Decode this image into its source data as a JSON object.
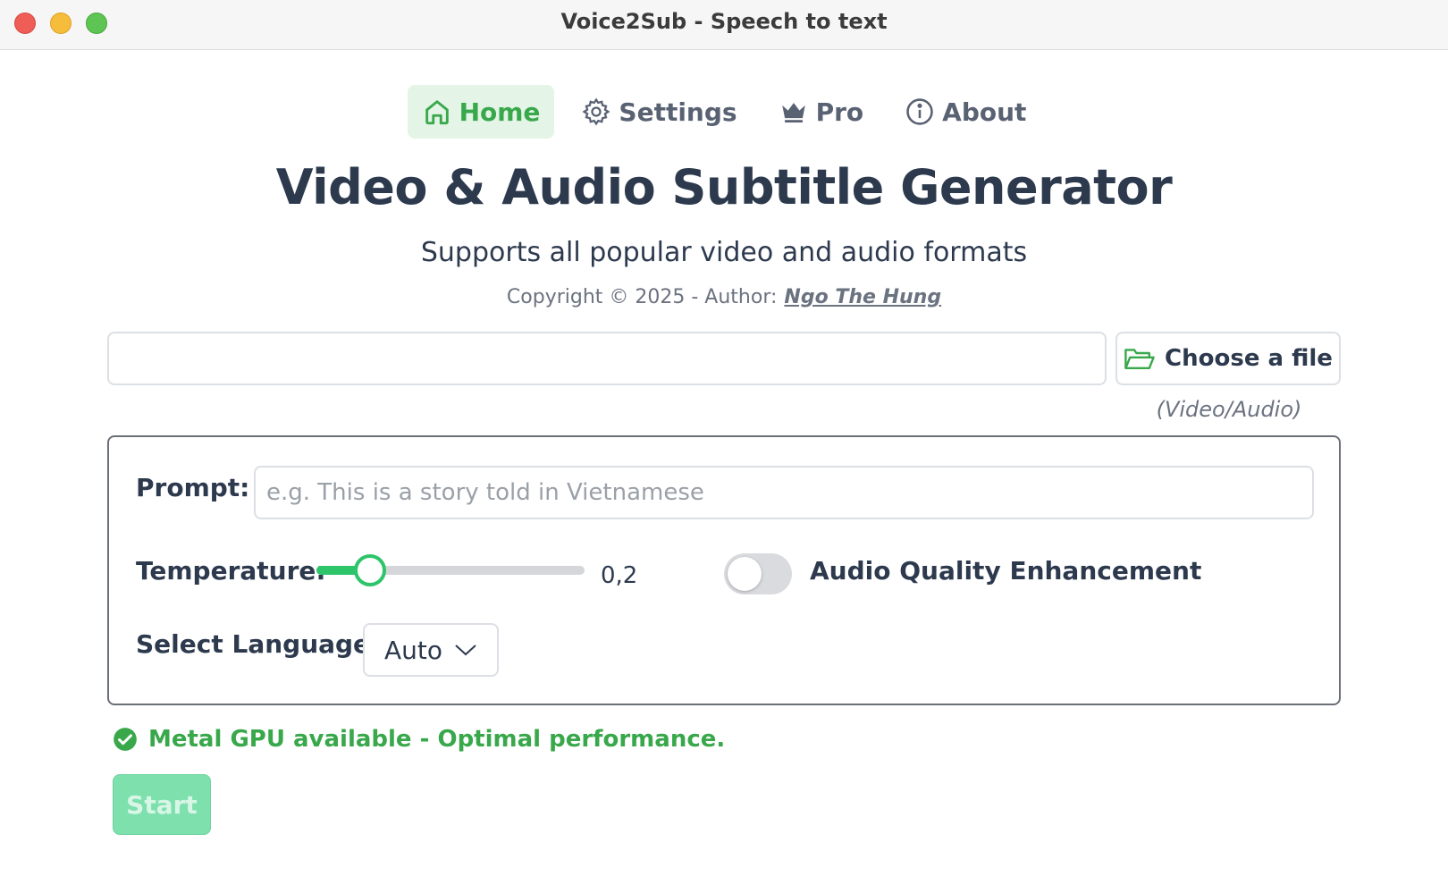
{
  "window": {
    "title": "Voice2Sub - Speech to text"
  },
  "nav": {
    "items": [
      {
        "label": "Home",
        "icon": "home-icon",
        "active": true
      },
      {
        "label": "Settings",
        "icon": "gear-icon",
        "active": false
      },
      {
        "label": "Pro",
        "icon": "crown-icon",
        "active": false
      },
      {
        "label": "About",
        "icon": "info-icon",
        "active": false
      }
    ]
  },
  "header": {
    "title": "Video & Audio Subtitle Generator",
    "subtitle": "Supports all popular video and audio formats",
    "copyright": "Copyright © 2025 - Author:",
    "author": "Ngo The Hung"
  },
  "file": {
    "value": "",
    "button_label": "Choose a file",
    "button_icon": "folder-open-icon",
    "hint": "(Video/Audio)"
  },
  "settings": {
    "prompt_label": "Prompt:",
    "prompt_value": "",
    "prompt_placeholder": "e.g. This is a story told in Vietnamese",
    "temperature_label": "Temperature:",
    "temperature_value": 0.2,
    "temperature_display": "0,2",
    "temperature_range": [
      0,
      1
    ],
    "enhancement_label": "Audio Quality Enhancement",
    "enhancement_on": false,
    "language_label": "Select Language:",
    "language_value": "Auto"
  },
  "status": {
    "text": "Metal GPU available - Optimal performance.",
    "icon": "check-circle-icon"
  },
  "actions": {
    "start_label": "Start",
    "start_enabled": false
  },
  "colors": {
    "accent": "#38a84b",
    "slider": "#2dc46a",
    "start_disabled": "#7de0ad",
    "text": "#2d3a4e"
  }
}
